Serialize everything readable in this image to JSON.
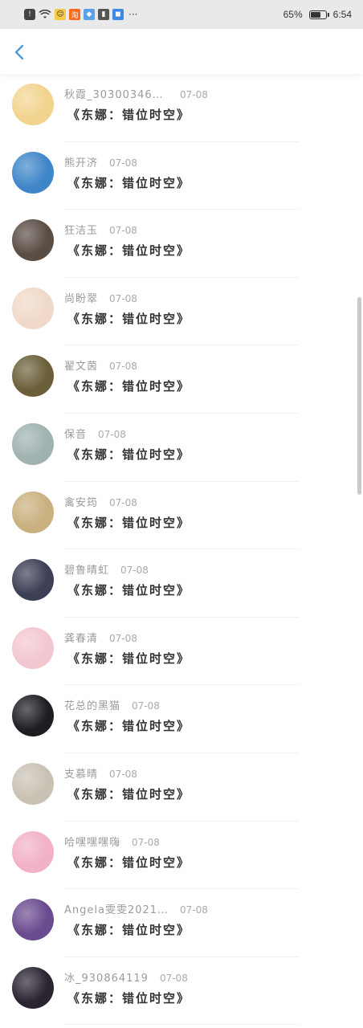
{
  "status_bar": {
    "icons": [
      "alert-icon",
      "wifi-icon",
      "chat-icon",
      "taobao-icon",
      "app-icon",
      "notify-icon",
      "app2-icon"
    ],
    "more": "···",
    "battery": "65%",
    "time": "6:54"
  },
  "header": {
    "back_icon": "chevron-left-icon"
  },
  "list": {
    "items": [
      {
        "name": "秋霞_30300346777…",
        "date": "07-08",
        "title": "《东娜：错位时空》",
        "avatar": "#f2d48f"
      },
      {
        "name": "熊开济",
        "date": "07-08",
        "title": "《东娜：错位时空》",
        "avatar": "#3f86c9"
      },
      {
        "name": "狂洁玉",
        "date": "07-08",
        "title": "《东娜：错位时空》",
        "avatar": "#5a4d44"
      },
      {
        "name": "尚盼翠",
        "date": "07-08",
        "title": "《东娜：错位时空》",
        "avatar": "#f0d9c8"
      },
      {
        "name": "翟文茵",
        "date": "07-08",
        "title": "《东娜：错位时空》",
        "avatar": "#6b5f3a"
      },
      {
        "name": "保音",
        "date": "07-08",
        "title": "《东娜：错位时空》",
        "avatar": "#9fb2b0"
      },
      {
        "name": "禽安筠",
        "date": "07-08",
        "title": "《东娜：错位时空》",
        "avatar": "#c9b07e"
      },
      {
        "name": "碧鲁晴虹",
        "date": "07-08",
        "title": "《东娜：错位时空》",
        "avatar": "#3c3f55"
      },
      {
        "name": "龚春清",
        "date": "07-08",
        "title": "《东娜：错位时空》",
        "avatar": "#f3c7cf"
      },
      {
        "name": "花总的黑猫",
        "date": "07-08",
        "title": "《东娜：错位时空》",
        "avatar": "#1f1d22"
      },
      {
        "name": "支慕晴",
        "date": "07-08",
        "title": "《东娜：错位时空》",
        "avatar": "#c9c2b4"
      },
      {
        "name": "哈嘿嘿嘿嗨",
        "date": "07-08",
        "title": "《东娜：错位时空》",
        "avatar": "#f2b1c7"
      },
      {
        "name": "Angela雯雯202107",
        "date": "07-08",
        "title": "《东娜：错位时空》",
        "avatar": "#6a4b8f"
      },
      {
        "name": "冰_930864119",
        "date": "07-08",
        "title": "《东娜：错位时空》",
        "avatar": "#2a2430"
      }
    ]
  },
  "colors": {
    "accent": "#4a9bdc",
    "name": "#9a9a9a",
    "title": "#333333"
  }
}
